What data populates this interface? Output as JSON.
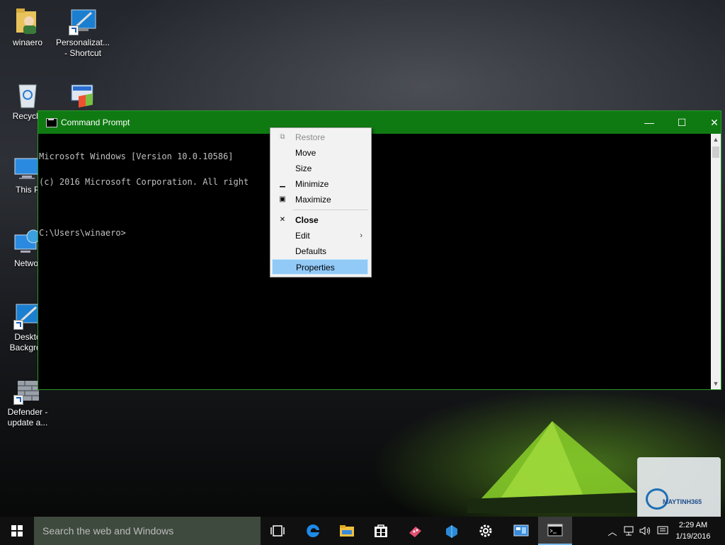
{
  "desktop": {
    "icons": [
      {
        "label": "winaero",
        "icon": "user-folder-icon"
      },
      {
        "label": "Personalizat... - Shortcut",
        "icon": "personalization-shortcut-icon"
      },
      {
        "label": "Recycle",
        "icon": "recycle-bin-icon"
      },
      {
        "label": "",
        "icon": "windows-app-icon"
      },
      {
        "label": "This P",
        "icon": "this-pc-icon"
      },
      {
        "label": "Networ",
        "icon": "network-icon"
      },
      {
        "label": "Deskto Backgrou",
        "icon": "desktop-background-shortcut-icon"
      },
      {
        "label": "Defender - update a...",
        "icon": "defender-update-shortcut-icon"
      }
    ]
  },
  "cmd": {
    "title": "Command Prompt",
    "controls": {
      "minimize": "—",
      "maximize": "☐",
      "close": "✕"
    },
    "lines": [
      "Microsoft Windows [Version 10.0.10586]",
      "(c) 2016 Microsoft Corporation. All right",
      "",
      "C:\\Users\\winaero>"
    ]
  },
  "context_menu": {
    "items": [
      {
        "label": "Restore",
        "icon": "restore-icon",
        "disabled": true
      },
      {
        "label": "Move"
      },
      {
        "label": "Size"
      },
      {
        "label": "Minimize",
        "icon": "minimize-icon"
      },
      {
        "label": "Maximize",
        "icon": "maximize-icon"
      },
      {
        "label": "Close",
        "icon": "close-icon",
        "bold": true
      },
      {
        "label": "Edit",
        "submenu": true
      },
      {
        "label": "Defaults"
      },
      {
        "label": "Properties",
        "highlighted": true
      }
    ],
    "highlight_color": "#91c9f7"
  },
  "taskbar": {
    "search_placeholder": "Search the web and Windows",
    "apps": [
      "task-view-icon",
      "edge-icon",
      "file-explorer-icon",
      "store-icon",
      "app-icon",
      "paint-app-icon",
      "settings-icon",
      "control-panel-icon",
      "command-prompt-icon"
    ],
    "clock": {
      "time": "2:29 AM",
      "date": "1/19/2016"
    }
  },
  "watermark": {
    "text": "MAYTINH365"
  }
}
